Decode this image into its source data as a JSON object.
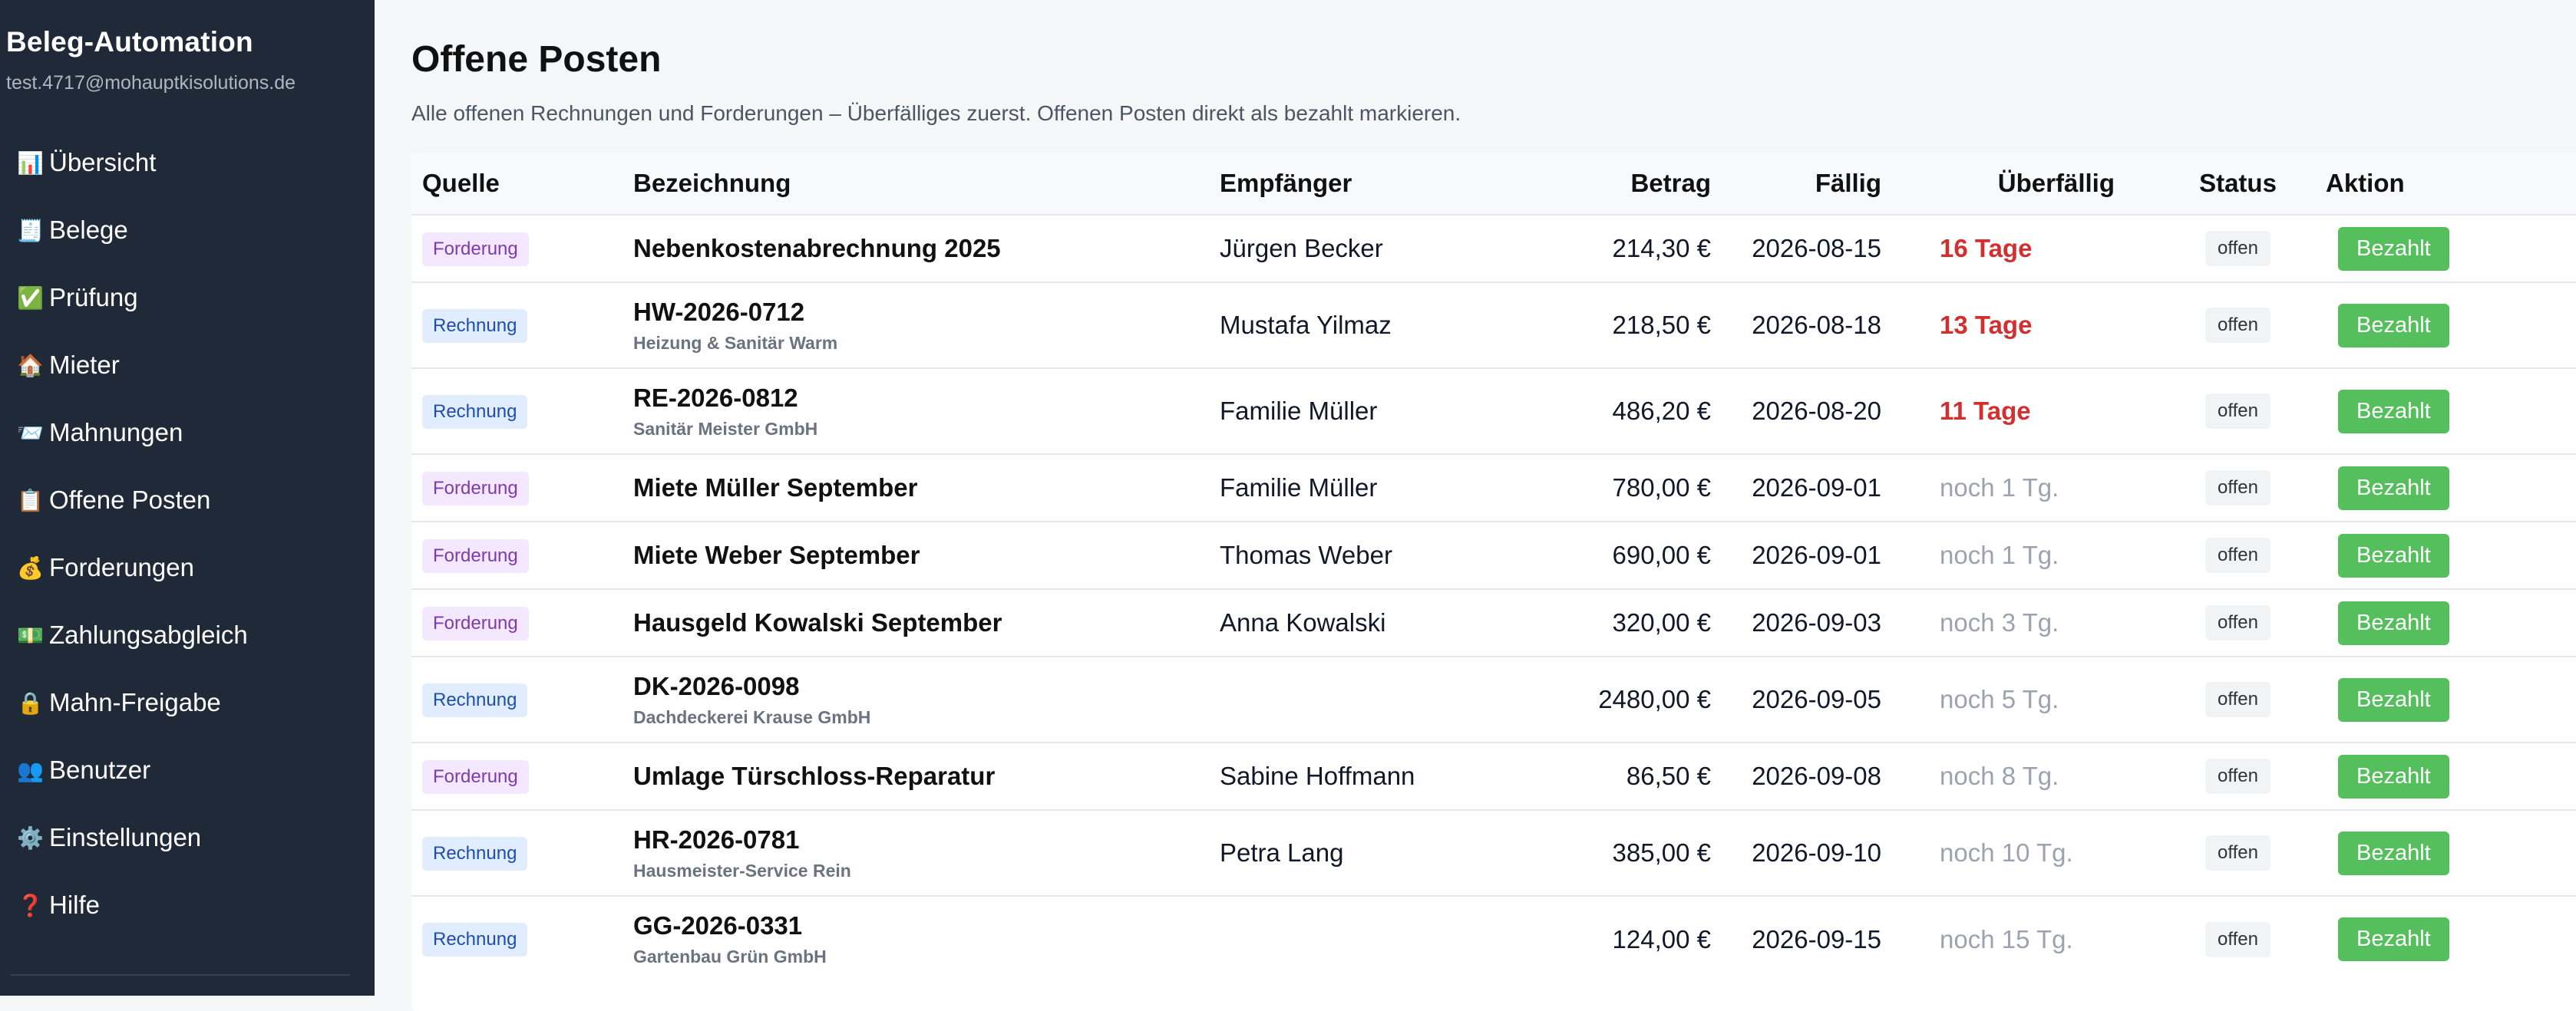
{
  "sidebar": {
    "brand": "Beleg-Automation",
    "user_email": "test.4717@mohauptkisolutions.de",
    "items": [
      {
        "icon": "📊",
        "label": "Übersicht"
      },
      {
        "icon": "🧾",
        "label": "Belege"
      },
      {
        "icon": "✅",
        "label": "Prüfung"
      },
      {
        "icon": "🏠",
        "label": "Mieter"
      },
      {
        "icon": "📨",
        "label": "Mahnungen"
      },
      {
        "icon": "📋",
        "label": "Offene Posten"
      },
      {
        "icon": "💰",
        "label": "Forderungen"
      },
      {
        "icon": "💵",
        "label": "Zahlungsabgleich"
      },
      {
        "icon": "🔒",
        "label": "Mahn-Freigabe"
      },
      {
        "icon": "👥",
        "label": "Benutzer"
      },
      {
        "icon": "⚙️",
        "label": "Einstellungen"
      },
      {
        "icon": "❓",
        "label": "Hilfe"
      }
    ]
  },
  "page": {
    "title": "Offene Posten",
    "subtitle": "Alle offenen Rechnungen und Forderungen – Überfälliges zuerst. Offenen Posten direkt als bezahlt markieren."
  },
  "table": {
    "headers": {
      "quelle": "Quelle",
      "bezeichnung": "Bezeichnung",
      "empfaenger": "Empfänger",
      "betrag": "Betrag",
      "faellig": "Fällig",
      "ueberfaellig": "Überfällig",
      "status": "Status",
      "aktion": "Aktion"
    },
    "rows": [
      {
        "quelle": "Forderung",
        "title": "Nebenkostenabrechnung 2025",
        "subtitle": "",
        "empfaenger": "Jürgen Becker",
        "betrag": "214,30 €",
        "faellig": "2026-08-15",
        "ueberfaellig": "16 Tage",
        "status": "offen",
        "aktion": "Bezahlt"
      },
      {
        "quelle": "Rechnung",
        "title": "HW-2026-0712",
        "subtitle": "Heizung & Sanitär Warm",
        "empfaenger": "Mustafa Yilmaz",
        "betrag": "218,50 €",
        "faellig": "2026-08-18",
        "ueberfaellig": "13 Tage",
        "status": "offen",
        "aktion": "Bezahlt"
      },
      {
        "quelle": "Rechnung",
        "title": "RE-2026-0812",
        "subtitle": "Sanitär Meister GmbH",
        "empfaenger": "Familie Müller",
        "betrag": "486,20 €",
        "faellig": "2026-08-20",
        "ueberfaellig": "11 Tage",
        "status": "offen",
        "aktion": "Bezahlt"
      },
      {
        "quelle": "Forderung",
        "title": "Miete Müller September",
        "subtitle": "",
        "empfaenger": "Familie Müller",
        "betrag": "780,00 €",
        "faellig": "2026-09-01",
        "ueberfaellig": "noch 1 Tg.",
        "status": "offen",
        "aktion": "Bezahlt"
      },
      {
        "quelle": "Forderung",
        "title": "Miete Weber September",
        "subtitle": "",
        "empfaenger": "Thomas Weber",
        "betrag": "690,00 €",
        "faellig": "2026-09-01",
        "ueberfaellig": "noch 1 Tg.",
        "status": "offen",
        "aktion": "Bezahlt"
      },
      {
        "quelle": "Forderung",
        "title": "Hausgeld Kowalski September",
        "subtitle": "",
        "empfaenger": "Anna Kowalski",
        "betrag": "320,00 €",
        "faellig": "2026-09-03",
        "ueberfaellig": "noch 3 Tg.",
        "status": "offen",
        "aktion": "Bezahlt"
      },
      {
        "quelle": "Rechnung",
        "title": "DK-2026-0098",
        "subtitle": "Dachdeckerei Krause GmbH",
        "empfaenger": "",
        "betrag": "2480,00 €",
        "faellig": "2026-09-05",
        "ueberfaellig": "noch 5 Tg.",
        "status": "offen",
        "aktion": "Bezahlt"
      },
      {
        "quelle": "Forderung",
        "title": "Umlage Türschloss-Reparatur",
        "subtitle": "",
        "empfaenger": "Sabine Hoffmann",
        "betrag": "86,50 €",
        "faellig": "2026-09-08",
        "ueberfaellig": "noch 8 Tg.",
        "status": "offen",
        "aktion": "Bezahlt"
      },
      {
        "quelle": "Rechnung",
        "title": "HR-2026-0781",
        "subtitle": "Hausmeister-Service Rein",
        "empfaenger": "Petra Lang",
        "betrag": "385,00 €",
        "faellig": "2026-09-10",
        "ueberfaellig": "noch 10 Tg.",
        "status": "offen",
        "aktion": "Bezahlt"
      },
      {
        "quelle": "Rechnung",
        "title": "GG-2026-0331",
        "subtitle": "Gartenbau Grün GmbH",
        "empfaenger": "",
        "betrag": "124,00 €",
        "faellig": "2026-09-15",
        "ueberfaellig": "noch 15 Tg.",
        "status": "offen",
        "aktion": "Bezahlt"
      }
    ]
  },
  "colors": {
    "sidebar_bg": "#1f2937",
    "overdue": "#d32f2f",
    "upcoming": "#9ca3af",
    "pay_button": "#54bf5c",
    "badge_forderung": "#7e3aae",
    "badge_rechnung": "#1d4fb0"
  }
}
